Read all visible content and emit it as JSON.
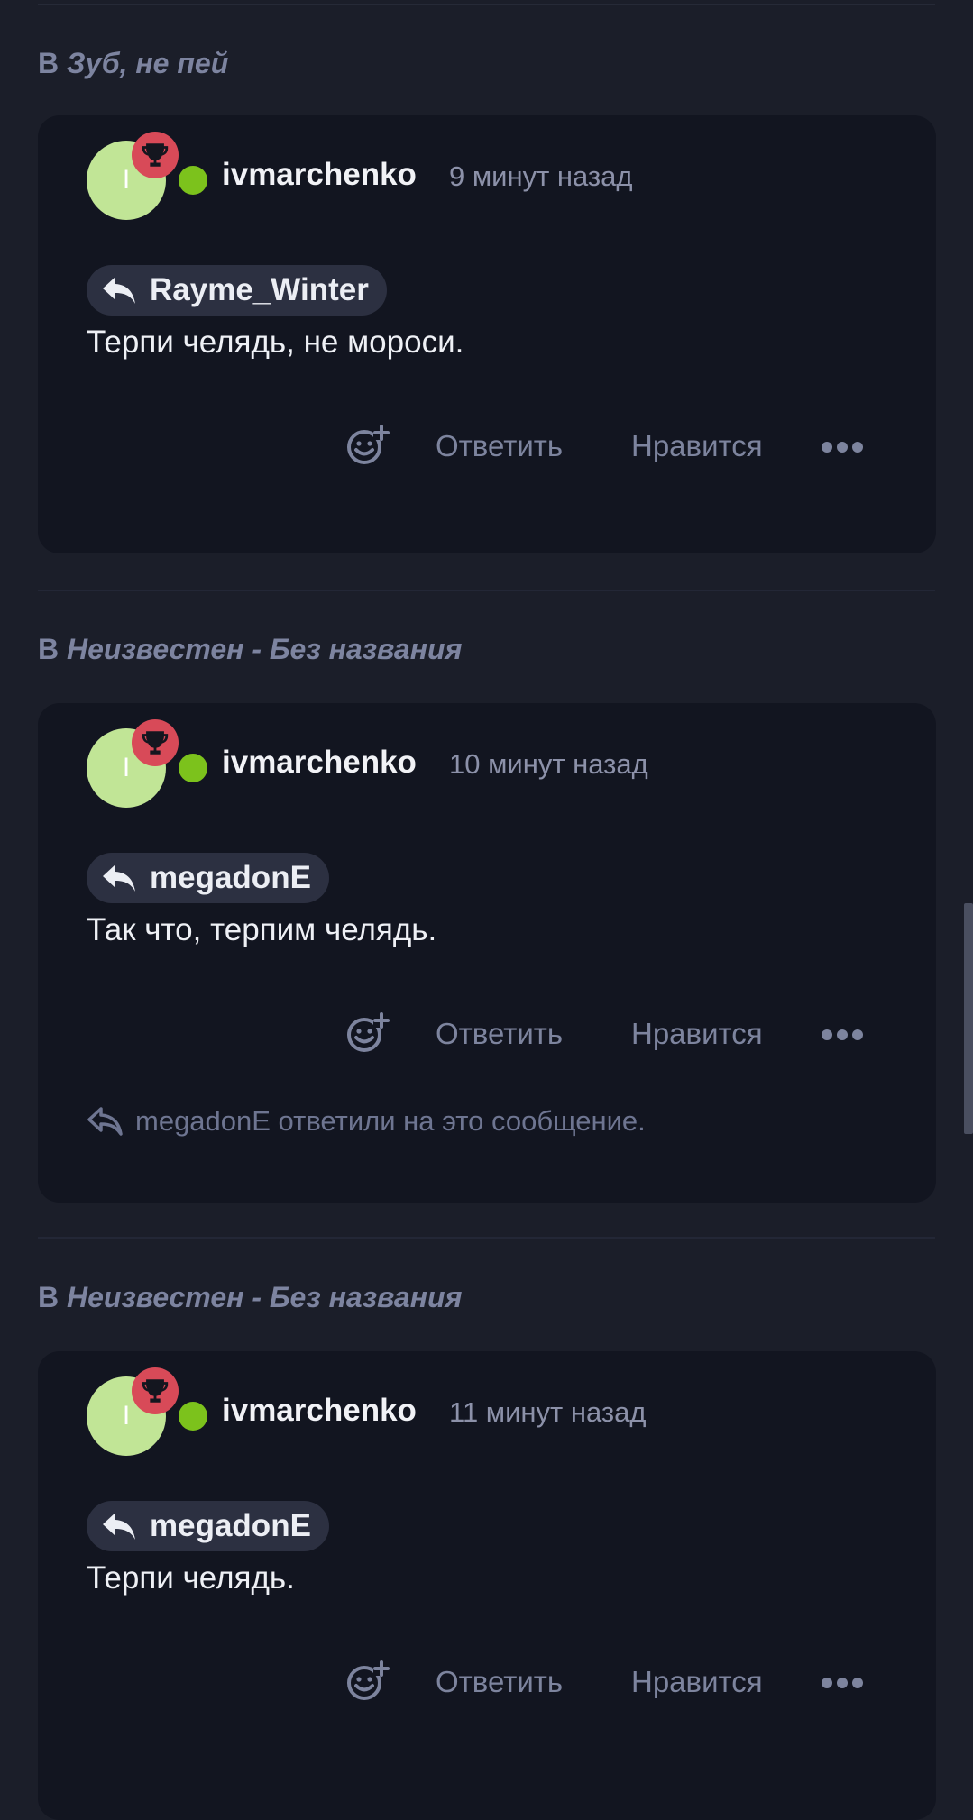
{
  "items": [
    {
      "prefix": "В",
      "topic": "Зуб, не пей",
      "avatar_letter": "I",
      "username": "ivmarchenko",
      "time": "9 минут назад",
      "reply_to": "Rayme_Winter",
      "message": "Терпи челядь, не мороси.",
      "reply_label": "Ответить",
      "like_label": "Нравится"
    },
    {
      "prefix": "В",
      "topic": "Неизвестен - Без названия",
      "avatar_letter": "I",
      "username": "ivmarchenko",
      "time": "10 минут назад",
      "reply_to": "megadonE",
      "message": "Так что, терпим челядь.",
      "reply_label": "Ответить",
      "like_label": "Нравится",
      "replied_note": "megadonE ответили на это сообщение."
    },
    {
      "prefix": "В",
      "topic": "Неизвестен - Без названия",
      "avatar_letter": "I",
      "username": "ivmarchenko",
      "time": "11 минут назад",
      "reply_to": "megadonE",
      "message": "Терпи челядь.",
      "reply_label": "Ответить",
      "like_label": "Нравится"
    }
  ],
  "icons": {
    "badge": "trophy-icon",
    "reply_chip": "reply-arrow-icon",
    "react": "add-reaction-icon",
    "more": "more-dots-icon"
  },
  "colors": {
    "background": "#1b1e29",
    "card": "#121520",
    "avatar": "#c1e596",
    "badge": "#d84a58",
    "online": "#7cc21c",
    "muted_text": "#7d849e"
  }
}
